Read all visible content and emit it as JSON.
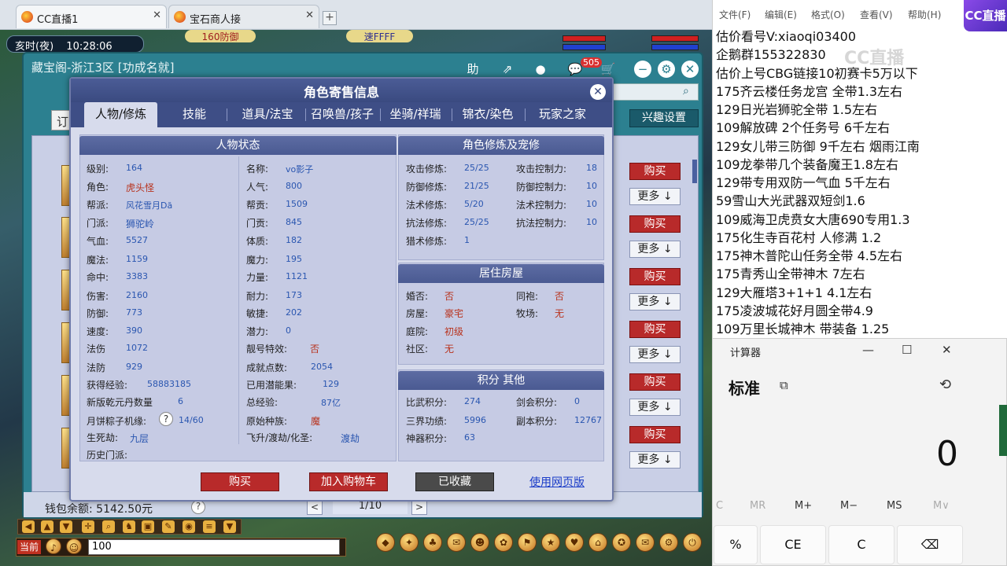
{
  "browser": {
    "tabs": [
      {
        "label": "CC直播1",
        "close": "✕"
      },
      {
        "label": "宝石商人接",
        "close": "✕"
      }
    ],
    "new_tab": "+"
  },
  "hud": {
    "time_label": "亥时(夜)",
    "time_value": "10:28:06",
    "banner1": "160防御",
    "banner2": "速FFFF"
  },
  "cbg": {
    "title": "藏宝阁-浙江3区 [功成名就]",
    "cart_count": "505",
    "icons": [
      "助",
      "⇗",
      "●",
      "💬",
      "🛒",
      "−",
      "⚙",
      "✕"
    ],
    "order_stub": "订",
    "interest_button": "兴趣设置",
    "buy_label": "购买",
    "more_label": "更多 ↓",
    "wallet": "钱包余额: 5142.50元",
    "help": "?",
    "page_prev": "<",
    "page_next": ">",
    "page": "1/10"
  },
  "modal": {
    "title": "角色寄售信息",
    "close": "✕",
    "tabs": [
      "人物/修炼",
      "技能",
      "道具/法宝",
      "召唤兽/孩子",
      "坐骑/祥瑞",
      "锦衣/染色",
      "玩家之家"
    ],
    "status_head": "人物状态",
    "status_left": [
      {
        "label": "级别:",
        "value": "164"
      },
      {
        "label": "角色:",
        "value": "虎头怪"
      },
      {
        "label": "帮派:",
        "value": "风花雪月Dă"
      },
      {
        "label": "门派:",
        "value": "狮驼岭"
      },
      {
        "label": "气血:",
        "value": "5527"
      },
      {
        "label": "魔法:",
        "value": "1159"
      },
      {
        "label": "命中:",
        "value": "3383"
      },
      {
        "label": "伤害:",
        "value": "2160"
      },
      {
        "label": "防御:",
        "value": "773"
      },
      {
        "label": "速度:",
        "value": "390"
      },
      {
        "label": "法伤",
        "value": "1072"
      },
      {
        "label": "法防",
        "value": "929"
      },
      {
        "label": "获得经验:",
        "value": "58883185"
      },
      {
        "label": "新版乾元丹数量",
        "value": "6"
      },
      {
        "label": "月饼粽子机缘:",
        "value": "14/60"
      },
      {
        "label": "生死劫:",
        "value": "九层"
      },
      {
        "label": "历史门派:",
        "value": ""
      }
    ],
    "status_right": [
      {
        "label": "名称:",
        "value": "vo影子"
      },
      {
        "label": "人气:",
        "value": "800"
      },
      {
        "label": "帮贡:",
        "value": "1509"
      },
      {
        "label": "门贡:",
        "value": "845"
      },
      {
        "label": "体质:",
        "value": "182"
      },
      {
        "label": "魔力:",
        "value": "195"
      },
      {
        "label": "力量:",
        "value": "1121"
      },
      {
        "label": "耐力:",
        "value": "173"
      },
      {
        "label": "敏捷:",
        "value": "202"
      },
      {
        "label": "潜力:",
        "value": "0"
      },
      {
        "label": "靓号特效:",
        "value": "否"
      },
      {
        "label": "成就点数:",
        "value": "2054"
      },
      {
        "label": "已用潜能果:",
        "value": "129"
      },
      {
        "label": "总经验:",
        "value": "87亿"
      },
      {
        "label": "原始种族:",
        "value": "魔"
      },
      {
        "label": "飞升/渡劫/化圣:",
        "value": "渡劫"
      }
    ],
    "mooncake_help": "?",
    "cultivation_head": "角色修炼及宠修",
    "cultivation_left": [
      {
        "label": "攻击修炼:",
        "value": "25/25"
      },
      {
        "label": "防御修炼:",
        "value": "21/25"
      },
      {
        "label": "法术修炼:",
        "value": "5/20"
      },
      {
        "label": "抗法修炼:",
        "value": "25/25"
      },
      {
        "label": "猎术修炼:",
        "value": "1"
      }
    ],
    "cultivation_right": [
      {
        "label": "攻击控制力:",
        "value": "18"
      },
      {
        "label": "防御控制力:",
        "value": "10"
      },
      {
        "label": "法术控制力:",
        "value": "10"
      },
      {
        "label": "抗法控制力:",
        "value": "10"
      }
    ],
    "house_head": "居住房屋",
    "house_left": [
      {
        "label": "婚否:",
        "value": "否"
      },
      {
        "label": "房屋:",
        "value": "豪宅"
      },
      {
        "label": "庭院:",
        "value": "初级"
      },
      {
        "label": "社区:",
        "value": "无"
      }
    ],
    "house_right": [
      {
        "label": "同袍:",
        "value": "否"
      },
      {
        "label": "牧场:",
        "value": "无"
      }
    ],
    "points_head": "积分 其他",
    "points_left": [
      {
        "label": "比武积分:",
        "value": "274"
      },
      {
        "label": "三界功绩:",
        "value": "5996"
      },
      {
        "label": "神器积分:",
        "value": "63"
      }
    ],
    "points_right": [
      {
        "label": "剑会积分:",
        "value": "0"
      },
      {
        "label": "副本积分:",
        "value": "12767"
      }
    ],
    "btn_buy": "购买",
    "btn_cart": "加入购物车",
    "btn_fav": "已收藏",
    "btn_web": "使用网页版"
  },
  "game_ui": {
    "channel": "当前",
    "chat_input": "100"
  },
  "notepad": {
    "menu": [
      "文件(F)",
      "编辑(E)",
      "格式(O)",
      "查看(V)",
      "帮助(H)"
    ],
    "lines": [
      "估价看号V:xiaoqi03400",
      "企鹅群155322830",
      "估价上号CBG链接10初赛卡5万以下",
      "175齐云楼任务龙宫  全带1.3左右",
      "129日光岩狮驼全带  1.5左右",
      "109解放碑 2个任务号 6千左右",
      "129女儿带三防御 9千左右 烟雨江南",
      "109龙拳带几个装备魔王1.8左右",
      "129带专用双防一气血 5千左右",
      "59雪山大光武器双短剑1.6",
      "109威海卫虎贲女大唐690专用1.3",
      "175化生寺百花村 人修满 1.2",
      "175神木普陀山任务全带 4.5左右",
      "175青秀山全带神木  7左右",
      "129大雁塔3+1+1  4.1左右",
      "175凌波城花好月圆全带4.9",
      "109万里长城神木 带装备  1.25"
    ],
    "logo": "CC直播",
    "watermark": "CC直播"
  },
  "calculator": {
    "title": "计算器",
    "min": "—",
    "max": "☐",
    "close": "✕",
    "mode": "标准",
    "mode_icon": "⧉",
    "history_icon": "⟲",
    "display": "0",
    "memory": [
      "C",
      "MR",
      "M+",
      "M−",
      "MS",
      "M∨"
    ],
    "keys": [
      "%",
      "CE",
      "C",
      "⌫"
    ]
  }
}
